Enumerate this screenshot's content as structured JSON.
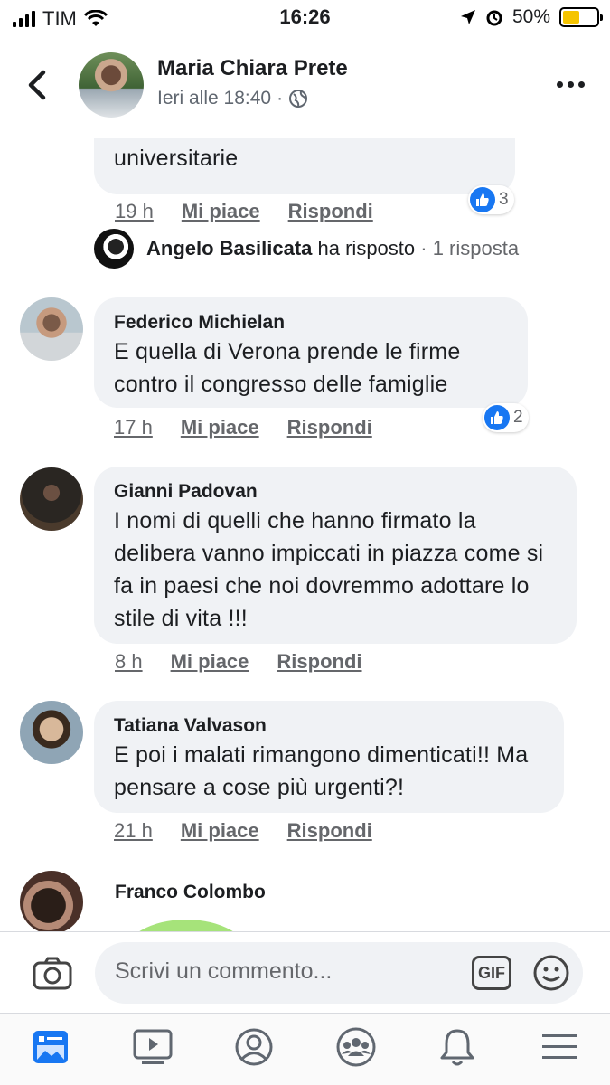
{
  "status_bar": {
    "carrier": "TIM",
    "time": "16:26",
    "battery": "50%",
    "battery_level": 0.5
  },
  "header": {
    "name": "Maria Chiara Prete",
    "subtitle": "Ieri alle 18:40",
    "privacy_icon": "globe-icon"
  },
  "comments": [
    {
      "text": "bellezza della famiglia. Vipere universitarie",
      "time": "19 h",
      "like_label": "Mi piace",
      "reply_label": "Rispondi",
      "reactions": "3"
    },
    {
      "name": "Federico Michielan",
      "text": "E quella di Verona prende le firme contro il congresso delle famiglie",
      "time": "17 h",
      "like_label": "Mi piace",
      "reply_label": "Rispondi",
      "reactions": "2"
    },
    {
      "name": "Gianni Padovan",
      "text": "I nomi di quelli che hanno firmato la delibera vanno impiccati in piazza come si fa in paesi che noi dovremmo adottare lo stile di vita !!!",
      "time": "8 h",
      "like_label": "Mi piace",
      "reply_label": "Rispondi"
    },
    {
      "name": "Tatiana Valvason",
      "text": "E poi i malati rimangono dimenticati!! Ma pensare a cose più urgenti?!",
      "time": "21 h",
      "like_label": "Mi piace",
      "reply_label": "Rispondi"
    },
    {
      "name": "Franco Colombo"
    }
  ],
  "reply_thread": {
    "name": "Angelo Basilicata",
    "action": "ha risposto",
    "count": "· 1 risposta"
  },
  "composer": {
    "placeholder": "Scrivi un commento...",
    "gif_label": "GIF"
  },
  "colors": {
    "like_blue": "#1877f2",
    "bubble_bg": "#f0f2f5",
    "battery_yellow": "#f5c400"
  }
}
